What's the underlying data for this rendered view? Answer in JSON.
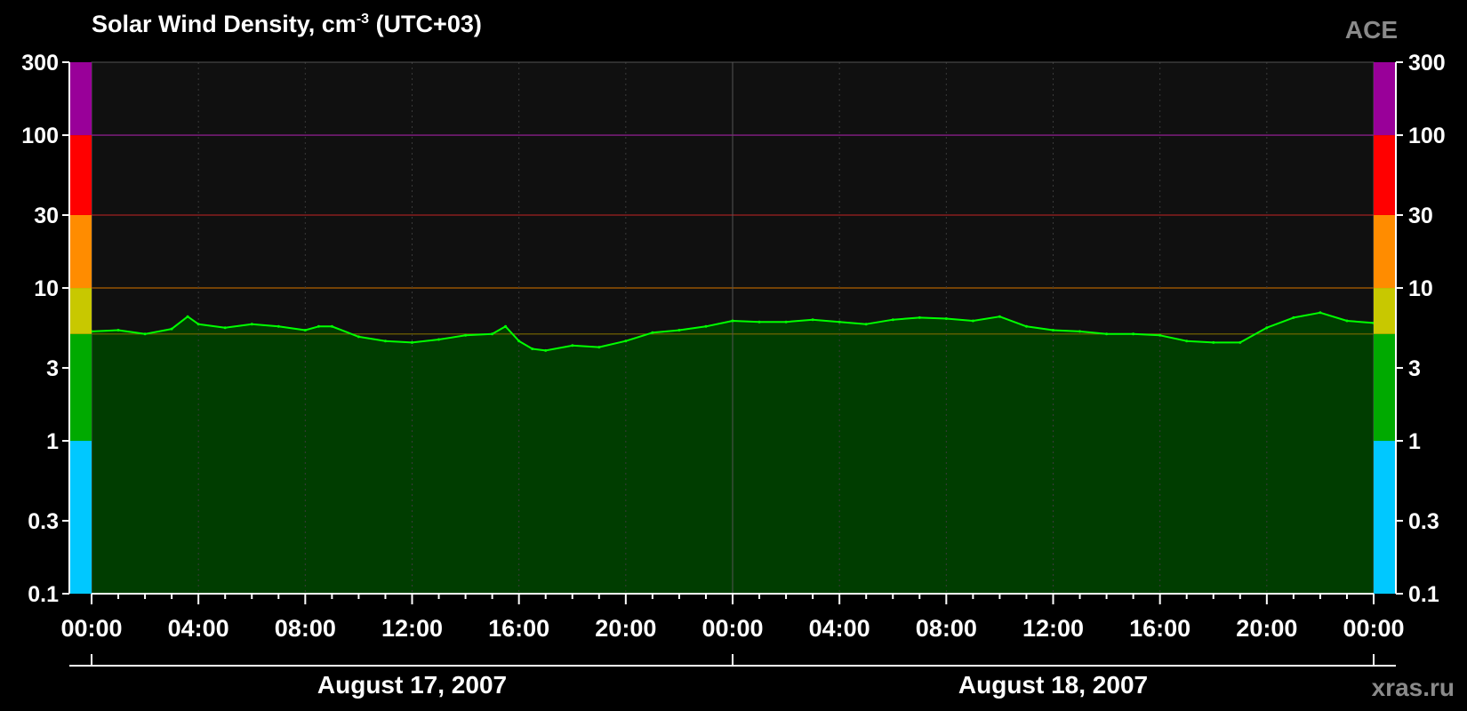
{
  "header": {
    "title_main": "Solar Wind Density, cm",
    "title_sup": "-3",
    "title_tail": " (UTC+03)",
    "source": "ACE",
    "site": "xras.ru"
  },
  "chart_data": {
    "type": "area",
    "title": "Solar Wind Density, cm-3 (UTC+03)",
    "xlabel": "",
    "ylabel": "",
    "y_scale": "log",
    "ylim": [
      0.1,
      300
    ],
    "y_ticks": [
      "0.1",
      "0.3",
      "1",
      "3",
      "10",
      "30",
      "100",
      "300"
    ],
    "x_range_hours": [
      0,
      48
    ],
    "x_ticks": [
      "00:00",
      "04:00",
      "08:00",
      "12:00",
      "16:00",
      "20:00",
      "00:00",
      "04:00",
      "08:00",
      "12:00",
      "16:00",
      "20:00",
      "00:00"
    ],
    "dates": [
      "August 17, 2007",
      "August 18, 2007"
    ],
    "thresholds": [
      {
        "value": 5,
        "color": "#7a6a00"
      },
      {
        "value": 10,
        "color": "#b06000"
      },
      {
        "value": 30,
        "color": "#a02020"
      },
      {
        "value": 100,
        "color": "#a020a0"
      }
    ],
    "level_bands": [
      {
        "from": 0.1,
        "to": 1,
        "color": "#00c8ff"
      },
      {
        "from": 1,
        "to": 5,
        "color": "#00aa00"
      },
      {
        "from": 5,
        "to": 10,
        "color": "#c8c800"
      },
      {
        "from": 10,
        "to": 30,
        "color": "#ff8c00"
      },
      {
        "from": 30,
        "to": 100,
        "color": "#ff0000"
      },
      {
        "from": 100,
        "to": 300,
        "color": "#990099"
      }
    ],
    "series": [
      {
        "color": "#00ff00",
        "fill": "#003d00",
        "x_hours": [
          0,
          1,
          2,
          3,
          3.6,
          4,
          5,
          6,
          7,
          8,
          8.5,
          9,
          10,
          11,
          12,
          13,
          14,
          15,
          15.5,
          16,
          16.5,
          17,
          18,
          19,
          20,
          21,
          22,
          23,
          24,
          25,
          26,
          27,
          28,
          29,
          30,
          31,
          32,
          33,
          34,
          35,
          36,
          37,
          38,
          39,
          40,
          41,
          42,
          43,
          44,
          45,
          46,
          47,
          48
        ],
        "y_values": [
          5.2,
          5.3,
          5.0,
          5.4,
          6.5,
          5.8,
          5.5,
          5.8,
          5.6,
          5.3,
          5.6,
          5.6,
          4.8,
          4.5,
          4.4,
          4.6,
          4.9,
          5.0,
          5.6,
          4.5,
          4.0,
          3.9,
          4.2,
          4.1,
          4.5,
          5.1,
          5.3,
          5.6,
          6.1,
          6.0,
          6.0,
          6.2,
          6.0,
          5.8,
          6.2,
          6.4,
          6.3,
          6.1,
          6.5,
          5.6,
          5.3,
          5.2,
          5.0,
          5.0,
          4.9,
          4.5,
          4.4,
          4.4,
          5.5,
          6.4,
          6.9,
          6.1,
          5.9
        ]
      }
    ]
  }
}
